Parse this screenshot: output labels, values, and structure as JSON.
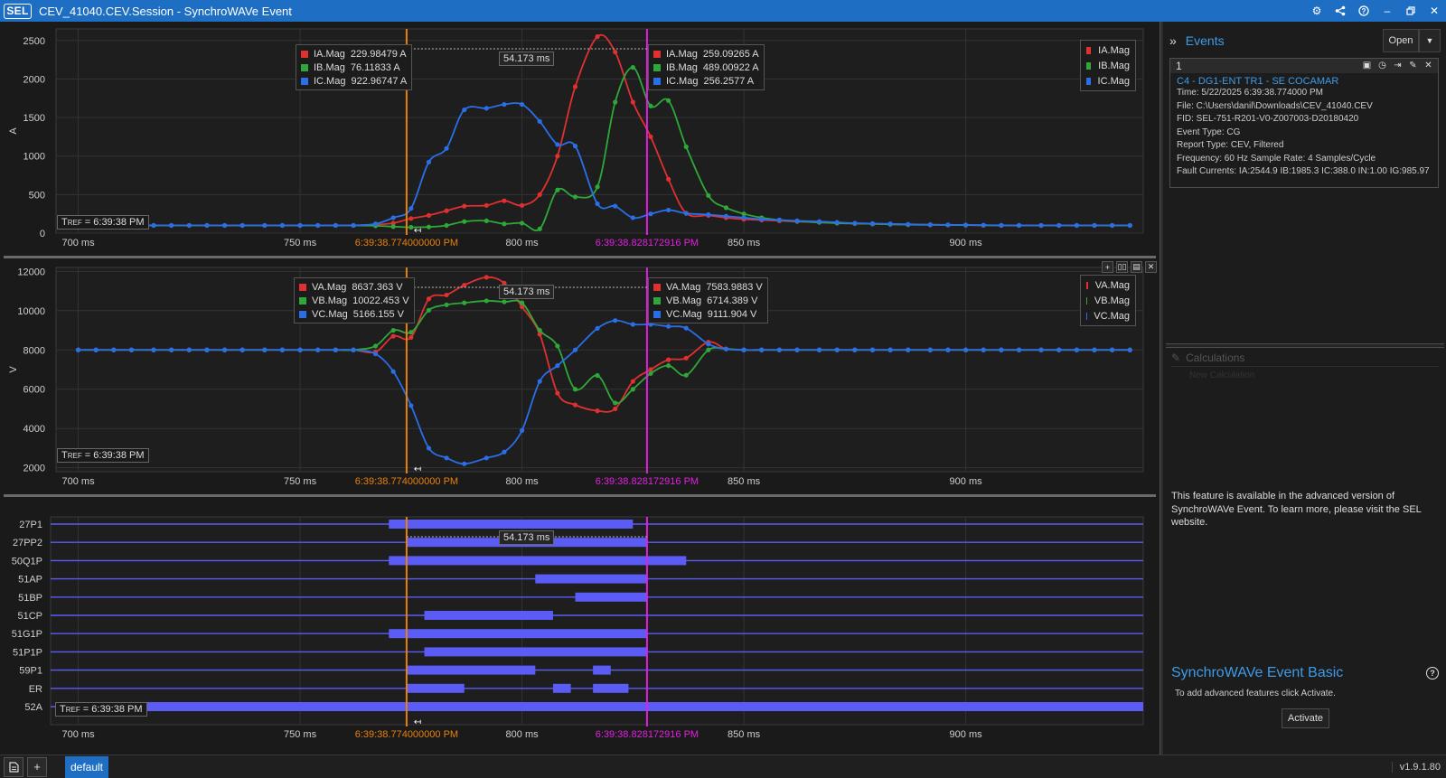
{
  "window": {
    "logo": "SEL",
    "title": "CEV_41040.CEV.Session - SynchroWAVe Event",
    "controls": [
      "⚙",
      "share",
      "?",
      "–",
      "restore",
      "✕"
    ]
  },
  "cursors": {
    "time1": "6:39:38.774000000 PM",
    "time2": "6:39:38.828172916 PM",
    "delta": "54.173 ms",
    "color1": "#e8820c",
    "color2": "#e020e0"
  },
  "tref": "TREF = 6:39:38 PM",
  "tref_parts": {
    "t": "T",
    "ref": "REF",
    "rest": " = 6:39:38 PM"
  },
  "x_axis": {
    "ticks": [
      "700 ms",
      "750 ms",
      "800 ms",
      "850 ms",
      "900 ms"
    ]
  },
  "current_plot": {
    "ylabel": "A",
    "yticks": [
      "0",
      "500",
      "1000",
      "1500",
      "2000",
      "2500"
    ],
    "legend": [
      {
        "name": "IA.Mag",
        "color": "#e03030"
      },
      {
        "name": "IB.Mag",
        "color": "#2fa83a"
      },
      {
        "name": "IC.Mag",
        "color": "#2a6ee8"
      }
    ],
    "cursor1_values": [
      {
        "name": "IA.Mag",
        "value": "229.98479 A"
      },
      {
        "name": "IB.Mag",
        "value": "76.11833 A"
      },
      {
        "name": "IC.Mag",
        "value": "922.96747 A"
      }
    ],
    "cursor2_values": [
      {
        "name": "IA.Mag",
        "value": "259.09265 A"
      },
      {
        "name": "IB.Mag",
        "value": "489.00922 A"
      },
      {
        "name": "IC.Mag",
        "value": "256.2577 A"
      }
    ]
  },
  "voltage_plot": {
    "ylabel": "V",
    "yticks": [
      "2000",
      "4000",
      "6000",
      "8000",
      "10000",
      "12000"
    ],
    "legend": [
      {
        "name": "VA.Mag",
        "color": "#e03030"
      },
      {
        "name": "VB.Mag",
        "color": "#2fa83a"
      },
      {
        "name": "VC.Mag",
        "color": "#2a6ee8"
      }
    ],
    "cursor1_values": [
      {
        "name": "VA.Mag",
        "value": "8637.363 V"
      },
      {
        "name": "VB.Mag",
        "value": "10022.453 V"
      },
      {
        "name": "VC.Mag",
        "value": "5166.155 V"
      }
    ],
    "cursor2_values": [
      {
        "name": "VA.Mag",
        "value": "7583.9883 V"
      },
      {
        "name": "VB.Mag",
        "value": "6714.389 V"
      },
      {
        "name": "VC.Mag",
        "value": "9111.904 V"
      }
    ],
    "tools": [
      "+",
      "▯▯",
      "▤",
      "✕"
    ]
  },
  "digital_plot": {
    "channels": [
      "27P1",
      "27PP2",
      "50Q1P",
      "51AP",
      "51BP",
      "51CP",
      "51G1P",
      "51P1P",
      "59P1",
      "ER",
      "52A"
    ],
    "bar_color": "#5a5cf5"
  },
  "chart_data": [
    {
      "type": "line",
      "title": "",
      "ylabel": "A",
      "xlabel": "",
      "x_unit": "ms",
      "xlim": [
        695,
        940
      ],
      "ylim": [
        0,
        2650
      ],
      "x": [
        700,
        704,
        708,
        712,
        717,
        721,
        725,
        729,
        733,
        737,
        742,
        746,
        750,
        754,
        758,
        762,
        767,
        771,
        775,
        779,
        783,
        787,
        792,
        796,
        800,
        804,
        808,
        812,
        817,
        821,
        825,
        829,
        833,
        837,
        842,
        846,
        850,
        854,
        858,
        862,
        867,
        871,
        875,
        879,
        883,
        887,
        892,
        896,
        900,
        904,
        908,
        912,
        917,
        921,
        925,
        929,
        933,
        937
      ],
      "series": [
        {
          "name": "IA.Mag",
          "values": [
            100,
            100,
            100,
            100,
            100,
            100,
            100,
            100,
            100,
            100,
            100,
            100,
            100,
            100,
            100,
            100,
            110,
            130,
            190,
            230,
            290,
            350,
            360,
            420,
            360,
            500,
            1000,
            1900,
            2550,
            2350,
            1700,
            1250,
            700,
            259,
            230,
            200,
            180,
            170,
            160,
            150,
            140,
            130,
            125,
            120,
            115,
            110,
            108,
            106,
            104,
            102,
            100,
            100,
            100,
            100,
            100,
            100,
            100,
            100
          ]
        },
        {
          "name": "IB.Mag",
          "values": [
            100,
            100,
            100,
            100,
            100,
            100,
            100,
            100,
            100,
            100,
            100,
            100,
            100,
            100,
            100,
            100,
            95,
            85,
            76,
            80,
            100,
            150,
            160,
            120,
            130,
            55,
            560,
            470,
            600,
            1700,
            2150,
            1650,
            1720,
            1120,
            489,
            330,
            250,
            200,
            170,
            155,
            140,
            130,
            125,
            120,
            115,
            110,
            108,
            106,
            104,
            102,
            100,
            100,
            100,
            100,
            100,
            100,
            100,
            100
          ]
        },
        {
          "name": "IC.Mag",
          "values": [
            100,
            100,
            100,
            100,
            100,
            100,
            100,
            100,
            100,
            100,
            100,
            100,
            100,
            100,
            100,
            100,
            120,
            200,
            320,
            922,
            1100,
            1600,
            1620,
            1670,
            1670,
            1450,
            1150,
            1130,
            380,
            350,
            200,
            250,
            300,
            256,
            240,
            220,
            200,
            180,
            170,
            160,
            150,
            140,
            130,
            125,
            120,
            115,
            110,
            108,
            106,
            104,
            102,
            100,
            100,
            100,
            100,
            100,
            100,
            100
          ]
        }
      ]
    },
    {
      "type": "line",
      "title": "",
      "ylabel": "V",
      "xlabel": "",
      "x_unit": "ms",
      "xlim": [
        695,
        940
      ],
      "ylim": [
        1800,
        12200
      ],
      "x": [
        700,
        704,
        708,
        712,
        717,
        721,
        725,
        729,
        733,
        737,
        742,
        746,
        750,
        754,
        758,
        762,
        767,
        771,
        775,
        779,
        783,
        787,
        792,
        796,
        800,
        804,
        808,
        812,
        817,
        821,
        825,
        829,
        833,
        837,
        842,
        846,
        850,
        854,
        858,
        862,
        867,
        871,
        875,
        879,
        883,
        887,
        892,
        896,
        900,
        904,
        908,
        912,
        917,
        921,
        925,
        929,
        933,
        937
      ],
      "series": [
        {
          "name": "VA.Mag",
          "values": [
            8000,
            8000,
            8000,
            8000,
            8000,
            8000,
            8000,
            8000,
            8000,
            8000,
            8000,
            8000,
            8000,
            8000,
            8000,
            8000,
            7900,
            8700,
            8637,
            10600,
            10800,
            11300,
            11700,
            11400,
            10200,
            8800,
            5800,
            5200,
            4900,
            5000,
            6400,
            7000,
            7500,
            7584,
            8400,
            8050,
            8000,
            8000,
            8000,
            8000,
            8000,
            8000,
            8000,
            8000,
            8000,
            8000,
            8000,
            8000,
            8000,
            8000,
            8000,
            8000,
            8000,
            8000,
            8000,
            8000,
            8000,
            8000
          ]
        },
        {
          "name": "VB.Mag",
          "values": [
            8000,
            8000,
            8000,
            8000,
            8000,
            8000,
            8000,
            8000,
            8000,
            8000,
            8000,
            8000,
            8000,
            8000,
            8000,
            8000,
            8200,
            9000,
            8900,
            10022,
            10300,
            10400,
            10500,
            10450,
            10400,
            9000,
            8200,
            6000,
            6700,
            5300,
            6000,
            6800,
            7200,
            6714,
            8000,
            8050,
            8000,
            8000,
            8000,
            8000,
            8000,
            8000,
            8000,
            8000,
            8000,
            8000,
            8000,
            8000,
            8000,
            8000,
            8000,
            8000,
            8000,
            8000,
            8000,
            8000,
            8000,
            8000
          ]
        },
        {
          "name": "VC.Mag",
          "values": [
            8000,
            8000,
            8000,
            8000,
            8000,
            8000,
            8000,
            8000,
            8000,
            8000,
            8000,
            8000,
            8000,
            8000,
            8000,
            8000,
            7800,
            6900,
            5166,
            3000,
            2500,
            2200,
            2500,
            2800,
            3900,
            6400,
            7200,
            8000,
            9100,
            9500,
            9300,
            9300,
            9200,
            9112,
            8300,
            8050,
            8000,
            8000,
            8000,
            8000,
            8000,
            8000,
            8000,
            8000,
            8000,
            8000,
            8000,
            8000,
            8000,
            8000,
            8000,
            8000,
            8000,
            8000,
            8000,
            8000,
            8000,
            8000
          ]
        }
      ]
    },
    {
      "type": "bar",
      "title": "",
      "ylabel": "",
      "xlabel": "",
      "x_unit": "ms",
      "xlim": [
        695,
        940
      ],
      "categories": [
        "27P1",
        "27PP2",
        "50Q1P",
        "51AP",
        "51BP",
        "51CP",
        "51G1P",
        "51P1P",
        "59P1",
        "ER",
        "52A"
      ],
      "series": [
        {
          "name": "27P1",
          "values": [
            [
              770,
              825
            ]
          ]
        },
        {
          "name": "27PP2",
          "values": [
            [
              774,
              828
            ]
          ]
        },
        {
          "name": "50Q1P",
          "values": [
            [
              770,
              837
            ]
          ]
        },
        {
          "name": "51AP",
          "values": [
            [
              803,
              828
            ]
          ]
        },
        {
          "name": "51BP",
          "values": [
            [
              812,
              828
            ]
          ]
        },
        {
          "name": "51CP",
          "values": [
            [
              778,
              807
            ]
          ]
        },
        {
          "name": "51G1P",
          "values": [
            [
              770,
              828
            ]
          ]
        },
        {
          "name": "51P1P",
          "values": [
            [
              778,
              828
            ]
          ]
        },
        {
          "name": "59P1",
          "values": [
            [
              774,
              803
            ],
            [
              816,
              820
            ]
          ]
        },
        {
          "name": "ER",
          "values": [
            [
              774,
              787
            ],
            [
              807,
              811
            ],
            [
              816,
              824
            ]
          ]
        },
        {
          "name": "52A",
          "values": [
            [
              695,
              940
            ]
          ]
        }
      ]
    }
  ],
  "events_panel": {
    "title": "Events",
    "open_label": "Open",
    "event_index": "1",
    "event_name": "C4 - DG1-ENT TR1 - SE COCAMAR",
    "details": [
      "Time: 5/22/2025 6:39:38.774000 PM",
      "File: C:\\Users\\danil\\Downloads\\CEV_41040.CEV",
      "FID: SEL-751-R201-V0-Z007003-D20180420",
      "Event Type: CG",
      "Report Type: CEV, Filtered",
      "Frequency: 60 Hz   Sample Rate: 4 Samples/Cycle",
      "Fault Currents: IA:2544.9 IB:1985.3 IC:388.0 IN:1.00 IG:985.97"
    ]
  },
  "calculations": {
    "title": "Calculations",
    "placeholder": "New Calculation"
  },
  "feature_note": "This feature is available in the advanced version of SynchroWAVe Event. To learn more, please visit the SEL website.",
  "basic": {
    "title": "SynchroWAVe Event Basic",
    "subtitle": "To add advanced features click Activate.",
    "activate_label": "Activate"
  },
  "bottom": {
    "tab_label": "default",
    "version": "v1.9.1.80"
  }
}
